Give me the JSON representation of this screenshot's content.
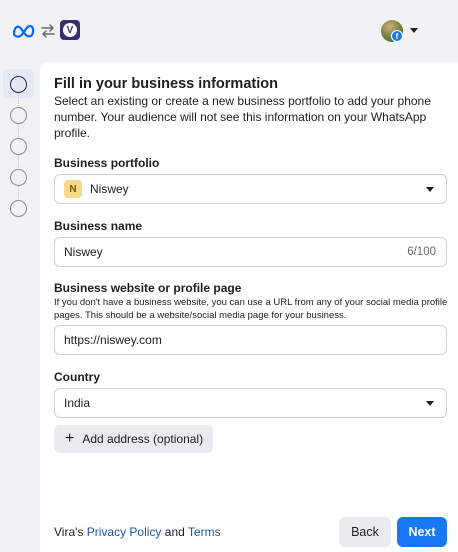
{
  "header": {
    "app_icon_letter": "V",
    "avatar_badge": "f",
    "icons": [
      "meta-logo-icon",
      "swap-icon",
      "vira-app-icon",
      "avatar",
      "caret-down-icon"
    ]
  },
  "stepper": {
    "total_steps": 5,
    "active_step": 1
  },
  "form": {
    "title": "Fill in your business information",
    "subtitle": "Select an existing or create a new business portfolio to add your phone number. Your audience will not see this information on your WhatsApp profile.",
    "business_portfolio": {
      "label": "Business portfolio",
      "badge": "N",
      "value": "Niswey"
    },
    "business_name": {
      "label": "Business name",
      "value": "Niswey",
      "counter": "6/100"
    },
    "website": {
      "label": "Business website or profile page",
      "help": "If you don't have a business website, you can use a URL from any of your social media profile pages. This should be a website/social media page for your business.",
      "value": "https://niswey.com"
    },
    "country": {
      "label": "Country",
      "value": "India"
    },
    "add_address": {
      "icon": "+",
      "label": "Add address (optional)"
    }
  },
  "footer": {
    "prefix": "Vira's ",
    "privacy_link": "Privacy Policy",
    "conjunction": " and ",
    "terms_link": "Terms",
    "back_label": "Back",
    "next_label": "Next"
  },
  "colors": {
    "primary": "#1877f2",
    "link": "#1a56b0",
    "background": "#f0f2f5",
    "app_icon": "#3b2e6e"
  }
}
